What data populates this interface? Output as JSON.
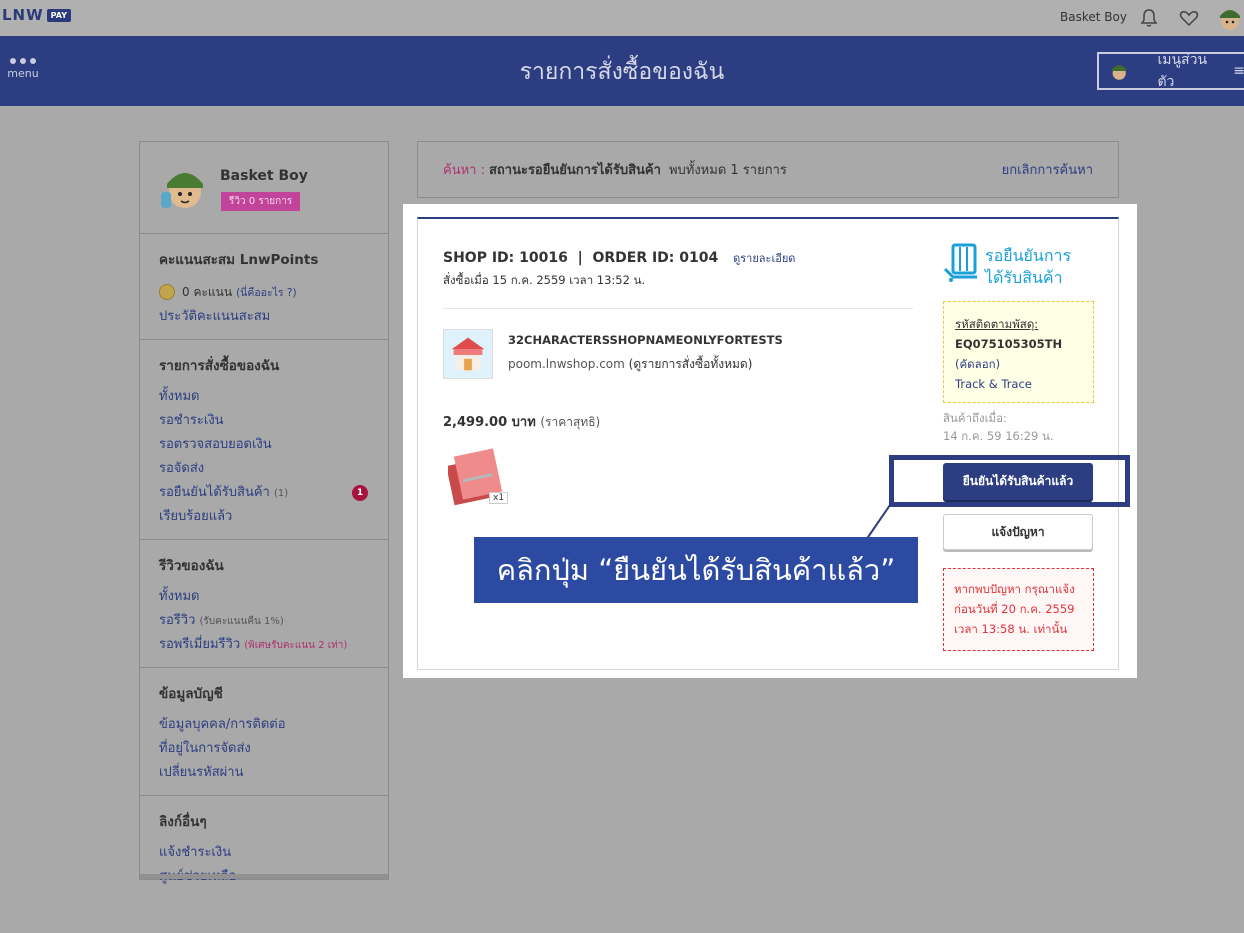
{
  "topbar": {
    "logo_text": "LNW",
    "logo_badge": "PAY",
    "username": "Basket Boy",
    "icons": [
      "bell-icon",
      "heart-icon",
      "avatar"
    ]
  },
  "header": {
    "menu_label": "menu",
    "title": "รายการสั่งซื้อของฉัน",
    "personal_menu_label": "เมนูส่วนตัว",
    "personal_menu_icon": "≡"
  },
  "sidebar": {
    "profile": {
      "name": "Basket Boy",
      "review_badge": "รีวิว 0 รายการ"
    },
    "points": {
      "heading": "คะแนนสะสม LnwPoints",
      "value": "0 คะแนน",
      "hint": "(นี่คืออะไร ?)",
      "history_link": "ประวัติคะแนนสะสม"
    },
    "orders": {
      "heading": "รายการสั่งซื้อของฉัน",
      "items": [
        {
          "label": "ทั้งหมด"
        },
        {
          "label": "รอชำระเงิน"
        },
        {
          "label": "รอตรวจสอบยอดเงิน"
        },
        {
          "label": "รอจัดส่ง"
        },
        {
          "label": "รอยืนยันได้รับสินค้า",
          "count": "(1)",
          "badge": "1"
        },
        {
          "label": "เรียบร้อยแล้ว"
        }
      ]
    },
    "reviews": {
      "heading": "รีวิวของฉัน",
      "items": [
        {
          "label": "ทั้งหมด"
        },
        {
          "label": "รอรีวิว",
          "note": "(รับคะแนนคืน 1%)"
        },
        {
          "label": "รอพรีเมี่ยมรีวิว",
          "note": "(พิเศษรับคะแนน 2 เท่า)"
        }
      ]
    },
    "account": {
      "heading": "ข้อมูลบัญชี",
      "items": [
        {
          "label": "ข้อมูลบุคคล/การติดต่อ"
        },
        {
          "label": "ที่อยู่ในการจัดส่ง"
        },
        {
          "label": "เปลี่ยนรหัสผ่าน"
        }
      ]
    },
    "links": {
      "heading": "ลิงก์อื่นๆ",
      "items": [
        {
          "label": "แจ้งชำระเงิน"
        },
        {
          "label": "ศูนย์ช่วยเหลือ"
        }
      ]
    }
  },
  "search": {
    "label": "ค้นหา :",
    "status": "สถานะรอยืนยันการได้รับสินค้า",
    "count": "พบทั้งหมด 1 รายการ",
    "cancel": "ยกเลิกการค้นหา"
  },
  "order": {
    "id_line": "SHOP ID: 10016  |  ORDER ID: 0104",
    "detail_link": "ดูรายละเอียด",
    "date": "สั่งซื้อเมื่อ 15 ก.ค. 2559 เวลา 13:52 น.",
    "shop_name": "32CHARACTERSSHOPNAMEONLYFORTESTS",
    "shop_url": "poom.lnwshop.com",
    "shop_orders_link": "(ดูรายการสั่งซื้อทั้งหมด)",
    "price": "2,499.00 บาท",
    "price_note": "(ราคาสุทธิ)",
    "quantity": "x1",
    "status_line1": "รอยืนยันการ",
    "status_line2": "ได้รับสินค้า",
    "tracking_label": "รหัสติดตามพัสดุ:",
    "tracking_number": "EQ075105305TH",
    "copy_link": "(คัดลอก)",
    "track_link": "Track & Trace",
    "arrived_label": "สินค้าถึงเมื่อ:",
    "arrived_date": "14 ก.ค. 59 16:29 น.",
    "confirm_button": "ยืนยันได้รับสินค้าแล้ว",
    "report_button": "แจ้งปัญหา",
    "warn_line1": "หากพบปัญหา กรุณาแจ้ง",
    "warn_line2": "ก่อนวันที่ 20 ก.ค. 2559",
    "warn_line3": "เวลา 13:58 น. เท่านั้น"
  },
  "annotation": {
    "callout_text": "คลิกปุ่ม “ยืนยันได้รับสินค้าแล้ว”"
  },
  "colors": {
    "header_bg": "#2c3e81",
    "accent_blue": "#1aa0d8",
    "pink": "#c2449a",
    "warning_red": "#e0343b"
  }
}
